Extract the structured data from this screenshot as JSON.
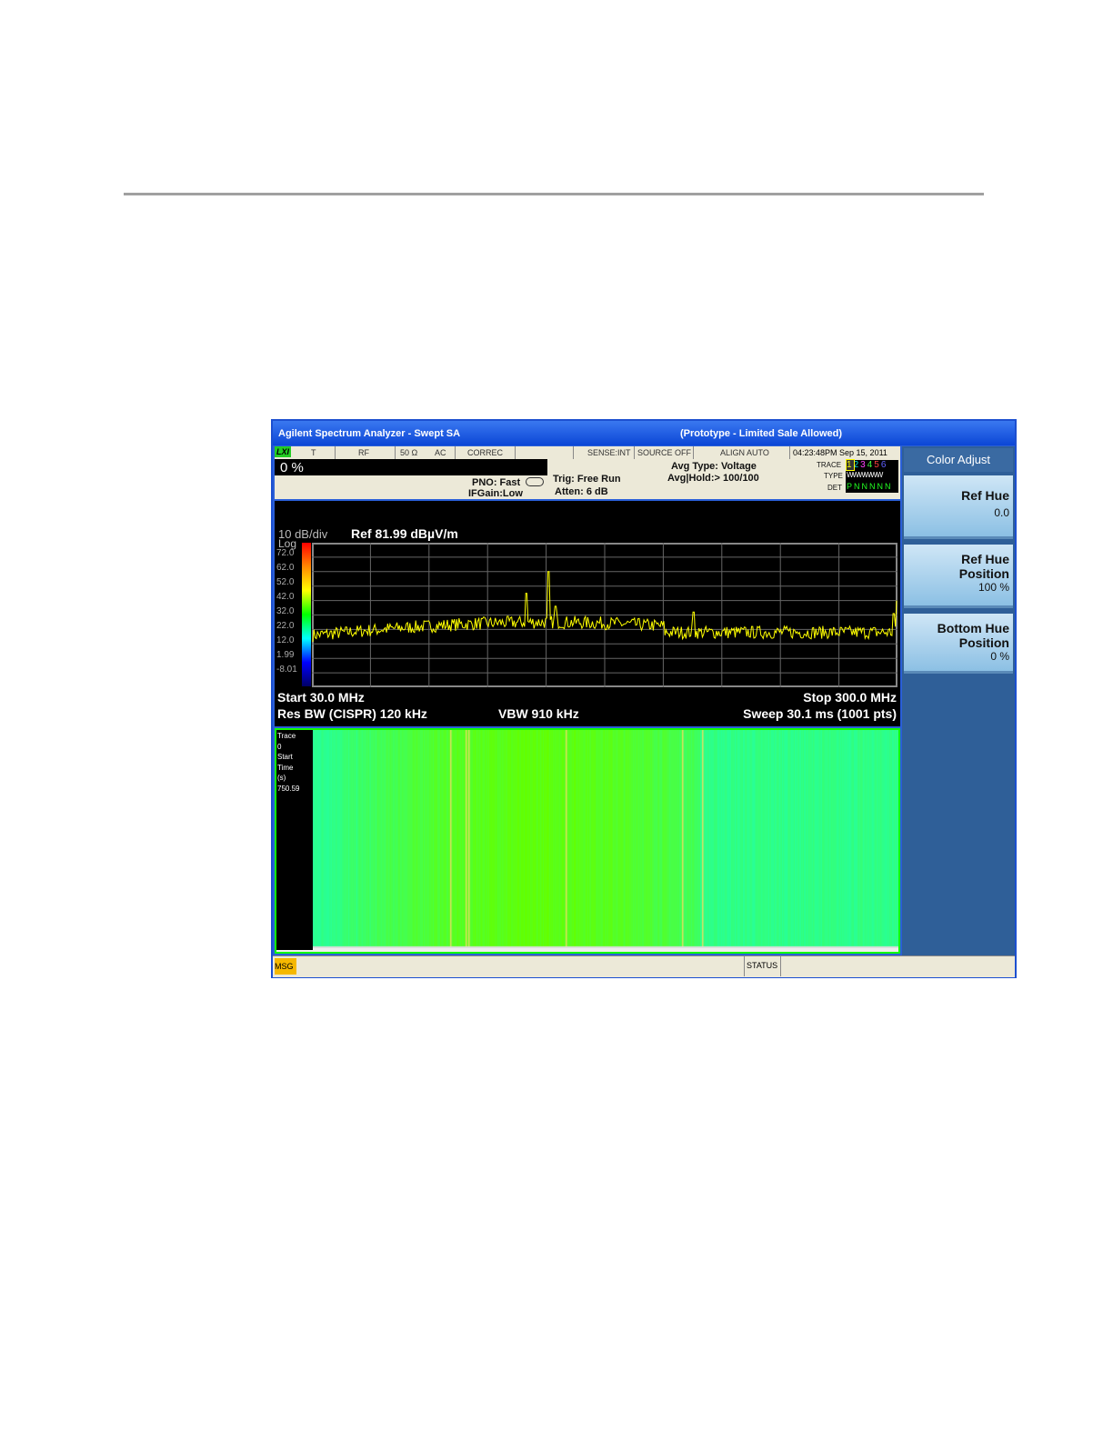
{
  "window": {
    "title": "Agilent Spectrum Analyzer - Swept SA",
    "notice": "(Prototype - Limited Sale Allowed)"
  },
  "status_bar": {
    "lxi": "LXI",
    "items": [
      "T",
      "RF",
      "50 Ω",
      "AC",
      "CORREC",
      "SENSE:INT",
      "SOURCE OFF",
      "ALIGN AUTO"
    ],
    "datetime": "04:23:48PM Sep 15, 2011"
  },
  "info": {
    "progress": "0 %",
    "pno": "PNO: Fast",
    "ifgain": "IFGain:Low",
    "trig": "Trig: Free Run",
    "atten": "Atten: 6 dB",
    "avg_type": "Avg Type: Voltage",
    "avg_hold": "Avg|Hold:> 100/100",
    "trace_label": "TRACE",
    "type_label": "TYPE",
    "det_label": "DET",
    "traces": [
      "1",
      "2",
      "3",
      "4",
      "5",
      "6"
    ],
    "trace_colors": [
      "#ffff00",
      "#00e0e0",
      "#ff40ff",
      "#40ff40",
      "#ff4040",
      "#6060ff"
    ],
    "type_value": "WWWWWW",
    "det_values": [
      "P",
      "N",
      "N",
      "N",
      "N",
      "N"
    ]
  },
  "display": {
    "scale": "10 dB/div",
    "ref": "Ref 81.99 dBµV/m",
    "log": "Log",
    "y_labels": [
      "72.0",
      "62.0",
      "52.0",
      "42.0",
      "32.0",
      "22.0",
      "12.0",
      "1.99",
      "-8.01"
    ],
    "start": "Start 30.0 MHz",
    "stop": "Stop 300.0 MHz",
    "rbw": "Res BW (CISPR)  120 kHz",
    "vbw": "VBW 910 kHz",
    "sweep": "Sweep  30.1 ms (1001 pts)",
    "trace_color": "#ffff00"
  },
  "waterfall": {
    "labels": [
      "Trace",
      "0",
      "Start",
      "Time",
      "(s)",
      "750.59"
    ]
  },
  "softkeys": {
    "title": "Color Adjust",
    "keys": [
      {
        "label1": "Ref Hue",
        "label2": "",
        "value": "0.0"
      },
      {
        "label1": "Ref Hue",
        "label2": "Position",
        "value": "100 %"
      },
      {
        "label1": "Bottom Hue",
        "label2": "Position",
        "value": "0 %"
      }
    ]
  },
  "bottom": {
    "msg": "MSG",
    "status": "STATUS"
  }
}
